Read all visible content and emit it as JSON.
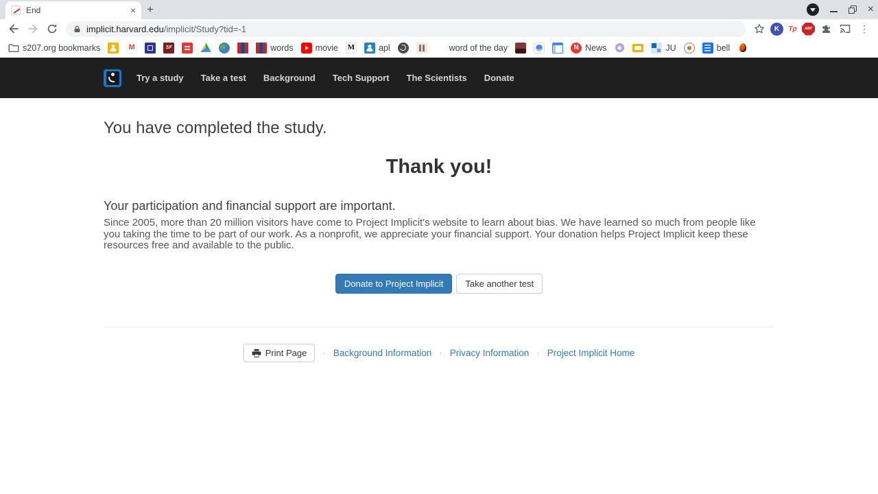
{
  "browser": {
    "tab_title": "End",
    "url_domain": "implicit.harvard.edu",
    "url_path": "/implicit/Study?tid=-1",
    "extensions": {
      "k": "K",
      "tp": "Tp",
      "abp": "ABP"
    },
    "bookmarks": [
      {
        "icon": "folder-icon",
        "label": "s207.org bookmarks"
      },
      {
        "icon": "classroom-icon",
        "label": ""
      },
      {
        "icon": "gmail-icon",
        "label": ""
      },
      {
        "icon": "library-icon",
        "label": ""
      },
      {
        "icon": "sf-icon",
        "label": ""
      },
      {
        "icon": "red-site-icon",
        "label": ""
      },
      {
        "icon": "drive-icon",
        "label": ""
      },
      {
        "icon": "earth-icon",
        "label": ""
      },
      {
        "icon": "flag-icon",
        "label": ""
      },
      {
        "icon": "flag-icon",
        "label": "words"
      },
      {
        "icon": "youtube-icon",
        "label": "movie"
      },
      {
        "icon": "medium-icon",
        "label": ""
      },
      {
        "icon": "person-icon",
        "label": "apl"
      },
      {
        "icon": "dark-globe-icon",
        "label": ""
      },
      {
        "icon": "figures-icon",
        "label": ""
      },
      {
        "icon": "color-grid-icon",
        "label": "word of the day"
      },
      {
        "icon": "maroon-image-icon",
        "label": ""
      },
      {
        "icon": "globe-icon",
        "label": ""
      },
      {
        "icon": "window-icon",
        "label": ""
      },
      {
        "icon": "news-icon",
        "label": "News"
      },
      {
        "icon": "flower-icon",
        "label": ""
      },
      {
        "icon": "orange-rect-icon",
        "label": ""
      },
      {
        "icon": "mosaic-icon",
        "label": "JU"
      },
      {
        "icon": "emblem-icon",
        "label": ""
      },
      {
        "icon": "doc-lines-icon",
        "label": "bell"
      },
      {
        "icon": "flame-icon",
        "label": ""
      }
    ],
    "gmail_letter": "M",
    "sf_letters": "SF",
    "medium_letter": "M",
    "news_letter": "N"
  },
  "icons": {
    "close": "×",
    "plus": "+",
    "menu": "⋮"
  },
  "navbar": {
    "items": [
      "Try a study",
      "Take a test",
      "Background",
      "Tech Support",
      "The Scientists",
      "Donate"
    ]
  },
  "main": {
    "heading": "You have completed the study.",
    "thank_you": "Thank you!",
    "subheading": "Your participation and financial support are important.",
    "paragraph": "Since 2005, more than 20 million visitors have come to Project Implicit's website to learn about bias. We have learned so much from people like you taking the time to be part of our work. As a nonprofit, we appreciate your financial support. Your donation helps Project Implicit keep these resources free and available to the public.",
    "donate_button": "Donate to Project Implicit",
    "take_test_button": "Take another test"
  },
  "footer": {
    "print_button": "Print Page",
    "separator": "·",
    "links": [
      "Background Information",
      "Privacy Information",
      "Project Implicit Home"
    ]
  },
  "colors": {
    "accent_blue": "#337ab7",
    "navbar_bg": "#1f1f1f",
    "logo_blue": "#1878c8",
    "link_blue": "#337ab7",
    "adblock_red": "#c62828"
  }
}
